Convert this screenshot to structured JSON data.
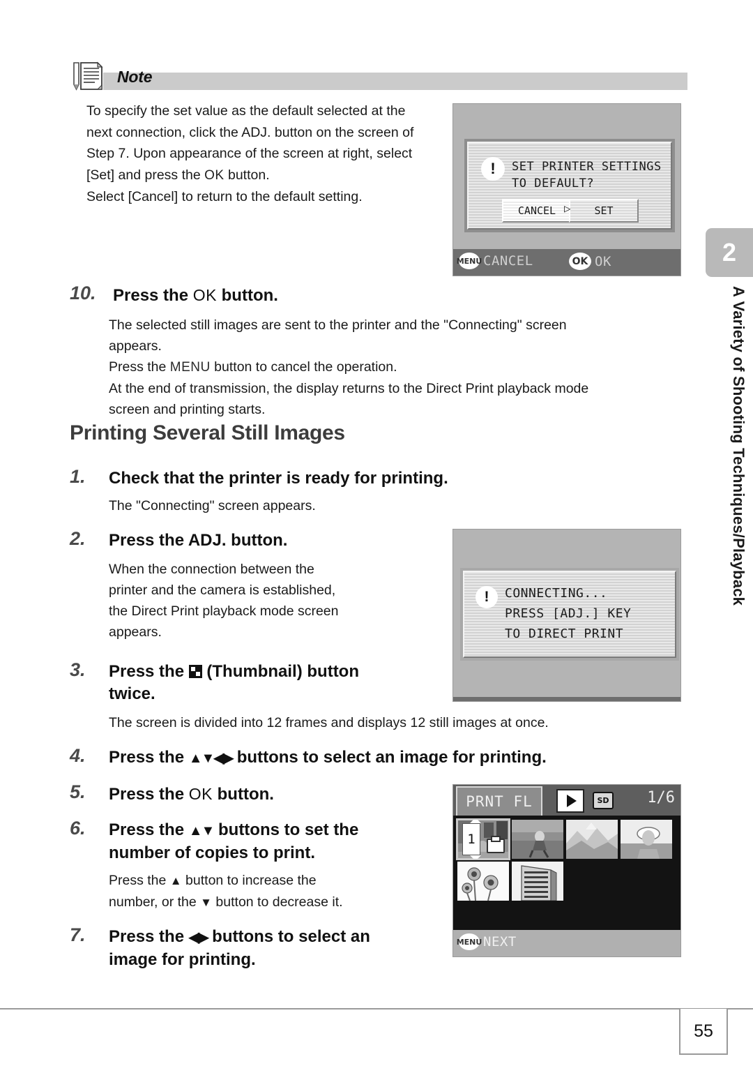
{
  "note": {
    "title": "Note",
    "lines": [
      "To specify the set value as the default selected at the",
      "next connection, click the ADJ. button on the screen of",
      "Step 7. Upon appearance of the screen at right, select",
      "[Set] and press the OK button.",
      "Select [Cancel] to return to the default setting."
    ],
    "line4_a": "[Set] and press the ",
    "line4_ok": "OK",
    "line4_b": " button.",
    "line5": "Select [Cancel] to return to the default setting."
  },
  "chapter": {
    "number": "2",
    "label": "A Variety of Shooting Techniques/Playback"
  },
  "step10": {
    "num": "10.",
    "title_a": "Press the ",
    "title_ok": "OK",
    "title_b": " button.",
    "body_line1": "The selected still images are sent to the printer and the \"Connecting\" screen",
    "body_line2": "appears.",
    "body_line3_a": "Press the ",
    "body_line3_menu": "MENU",
    "body_line3_b": " button to cancel the operation.",
    "body_line4": "At the end of transmission, the display returns to the Direct Print playback mode",
    "body_line5": "screen and printing starts."
  },
  "heading": "Printing Several Still Images",
  "steps": [
    {
      "num": "1.",
      "title": "Check that the printer is ready for printing.",
      "body": "The \"Connecting\" screen appears."
    },
    {
      "num": "2.",
      "title": "Press the ADJ. button.",
      "body_lines": [
        "When the connection between the",
        "printer and the camera is established,",
        "the Direct Print playback mode screen",
        "appears."
      ]
    },
    {
      "num": "3.",
      "title_a": "Press the ",
      "title_icon": "thumbnail-icon",
      "title_b": " (Thumbnail) button",
      "title_line2": "twice.",
      "body": "The screen is divided into 12 frames and displays 12 still images at once."
    },
    {
      "num": "4.",
      "title_a": "Press the ",
      "title_arrows": "▲▼◀▶",
      "title_b": " buttons to select an image for printing."
    },
    {
      "num": "5.",
      "title_a": "Press the ",
      "title_ok": "OK",
      "title_b": " button."
    },
    {
      "num": "6.",
      "title_a": "Press the ",
      "title_arrows": "▲▼",
      "title_b": " buttons to set the",
      "title_line2": "number of copies to print.",
      "body_line1_a": "Press the ",
      "body_line1_arrow": "▲",
      "body_line1_b": " button to increase the",
      "body_line2_a": "number, or the ",
      "body_line2_arrow": "▼",
      "body_line2_b": " button to decrease it."
    },
    {
      "num": "7.",
      "title_a": "Press the ",
      "title_arrows": "◀▶",
      "title_b": " buttons to select an",
      "title_line2": "image for printing."
    }
  ],
  "lcd_dialog_default": {
    "name": "set-printer-settings-dialog",
    "message_line1": "SET PRINTER SETTINGS",
    "message_line2": "TO DEFAULT?",
    "bang": "!",
    "button_cancel": "CANCEL",
    "button_set": "SET",
    "arrow": "▷",
    "guide_menu_pill": "MENU",
    "guide_menu_text": "CANCEL",
    "guide_ok_pill": "OK",
    "guide_ok_text": "OK"
  },
  "lcd_connecting": {
    "name": "connecting-dialog",
    "bang": "!",
    "line1": "CONNECTING...",
    "line2": "PRESS [ADJ.] KEY",
    "line3": "TO DIRECT PRINT"
  },
  "lcd_playback": {
    "name": "print-file-thumbnail-screen",
    "tag": "PRNT FL",
    "sd_label": "SD",
    "counter": "1/6",
    "copy_count": "1",
    "guide_pill": "MENU",
    "guide_text": "NEXT",
    "thumbnails": [
      {
        "id": "thumb-1",
        "caption": "portrait-selected",
        "selected": true
      },
      {
        "id": "thumb-2",
        "caption": "runner"
      },
      {
        "id": "thumb-3",
        "caption": "mountains"
      },
      {
        "id": "thumb-4",
        "caption": "woman-with-hat"
      },
      {
        "id": "thumb-5",
        "caption": "sunflowers"
      },
      {
        "id": "thumb-6",
        "caption": "building"
      }
    ]
  },
  "footer": {
    "page_number": "55"
  },
  "colors": {
    "note_bar": "#cbcbcb",
    "chapter_tab": "#b9b9b9",
    "heading": "#3c3c3c",
    "step_number": "#4a4a4a"
  }
}
